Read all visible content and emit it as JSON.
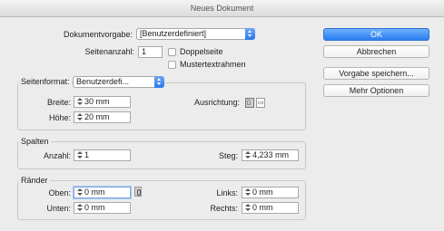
{
  "window": {
    "title": "Neues Dokument"
  },
  "preset": {
    "label": "Dokumentvorgabe:",
    "value": "[Benutzerdefiniert]"
  },
  "pages": {
    "label": "Seitenanzahl:",
    "value": "1",
    "facing_pages_label": "Doppelseite",
    "facing_pages_checked": false,
    "master_text_frame_label": "Mustertextrahmen",
    "master_text_frame_checked": false
  },
  "page_size": {
    "title": "Seitenformat:",
    "value": "Benutzerdefi...",
    "width_label": "Breite:",
    "width_value": "30 mm",
    "height_label": "Höhe:",
    "height_value": "20 mm",
    "orientation_label": "Ausrichtung:",
    "orientation_options": [
      "portrait",
      "landscape"
    ],
    "orientation_selected": "portrait"
  },
  "columns": {
    "title": "Spalten",
    "number_label": "Anzahl:",
    "number_value": "1",
    "gutter_label": "Steg:",
    "gutter_value": "4,233 mm"
  },
  "margins": {
    "title": "Ränder",
    "top_label": "Oben:",
    "top_value": "0 mm",
    "bottom_label": "Unten:",
    "bottom_value": "0 mm",
    "left_label": "Links:",
    "left_value": "0 mm",
    "right_label": "Rechts:",
    "right_value": "0 mm",
    "linked": true
  },
  "buttons": {
    "ok": "OK",
    "cancel": "Abbrechen",
    "save_preset": "Vorgabe speichern...",
    "more_options": "Mehr Optionen"
  },
  "colors": {
    "accent": "#2a7ef0",
    "background": "#ececec"
  }
}
